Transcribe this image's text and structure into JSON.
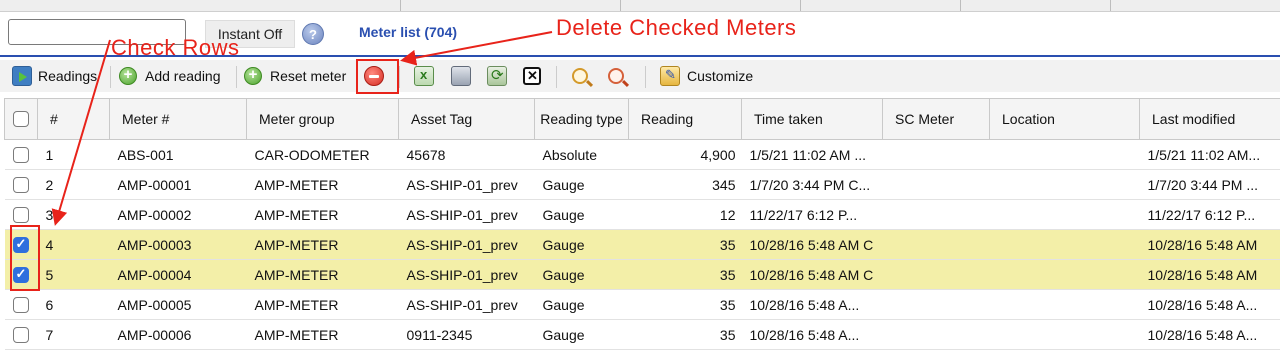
{
  "search": {
    "value": "",
    "placeholder": ""
  },
  "instant_label": "Instant Off",
  "help_icon": "help-icon",
  "meter_list_title": "Meter list (704)",
  "toolbar": {
    "readings": "Readings",
    "add_reading": "Add reading",
    "reset_meter": "Reset meter",
    "customize": "Customize"
  },
  "columns": [
    "#",
    "Meter #",
    "Meter group",
    "Asset Tag",
    "Reading type",
    "Reading",
    "Time taken",
    "SC Meter",
    "Location",
    "Last modified"
  ],
  "rows": [
    {
      "n": "1",
      "meter": "ABS-001",
      "group": "CAR-ODOMETER",
      "tag": "45678",
      "type": "Absolute",
      "reading": "4,900",
      "time": "1/5/21 11:02 AM ...",
      "sc": "",
      "loc": "",
      "modified": "1/5/21 11:02 AM...",
      "checked": false
    },
    {
      "n": "2",
      "meter": "AMP-00001",
      "group": "AMP-METER",
      "tag": "AS-SHIP-01_prev",
      "type": "Gauge",
      "reading": "345",
      "time": "1/7/20 3:44 PM C...",
      "sc": "",
      "loc": "",
      "modified": "1/7/20 3:44 PM ...",
      "checked": false
    },
    {
      "n": "3",
      "meter": "AMP-00002",
      "group": "AMP-METER",
      "tag": "AS-SHIP-01_prev",
      "type": "Gauge",
      "reading": "12",
      "time": "11/22/17 6:12 P...",
      "sc": "",
      "loc": "",
      "modified": "11/22/17 6:12 P...",
      "checked": false
    },
    {
      "n": "4",
      "meter": "AMP-00003",
      "group": "AMP-METER",
      "tag": "AS-SHIP-01_prev",
      "type": "Gauge",
      "reading": "35",
      "time": "10/28/16 5:48 AM C",
      "sc": "",
      "loc": "",
      "modified": "10/28/16 5:48 AM",
      "checked": true
    },
    {
      "n": "5",
      "meter": "AMP-00004",
      "group": "AMP-METER",
      "tag": "AS-SHIP-01_prev",
      "type": "Gauge",
      "reading": "35",
      "time": "10/28/16 5:48 AM C",
      "sc": "",
      "loc": "",
      "modified": "10/28/16 5:48 AM",
      "checked": true
    },
    {
      "n": "6",
      "meter": "AMP-00005",
      "group": "AMP-METER",
      "tag": "AS-SHIP-01_prev",
      "type": "Gauge",
      "reading": "35",
      "time": "10/28/16 5:48 A...",
      "sc": "",
      "loc": "",
      "modified": "10/28/16 5:48 A...",
      "checked": false
    },
    {
      "n": "7",
      "meter": "AMP-00006",
      "group": "AMP-METER",
      "tag": "0911-2345",
      "type": "Gauge",
      "reading": "35",
      "time": "10/28/16 5:48 A...",
      "sc": "",
      "loc": "",
      "modified": "10/28/16 5:48 A...",
      "checked": false
    }
  ],
  "annotations": {
    "delete_label": "Delete Checked Meters",
    "check_label": "Check Rows",
    "color": "#e8231a"
  },
  "colors": {
    "accent": "#2a4fb0",
    "selected_row": "#f3efa8",
    "checkbox_on": "#2f6fdd"
  }
}
